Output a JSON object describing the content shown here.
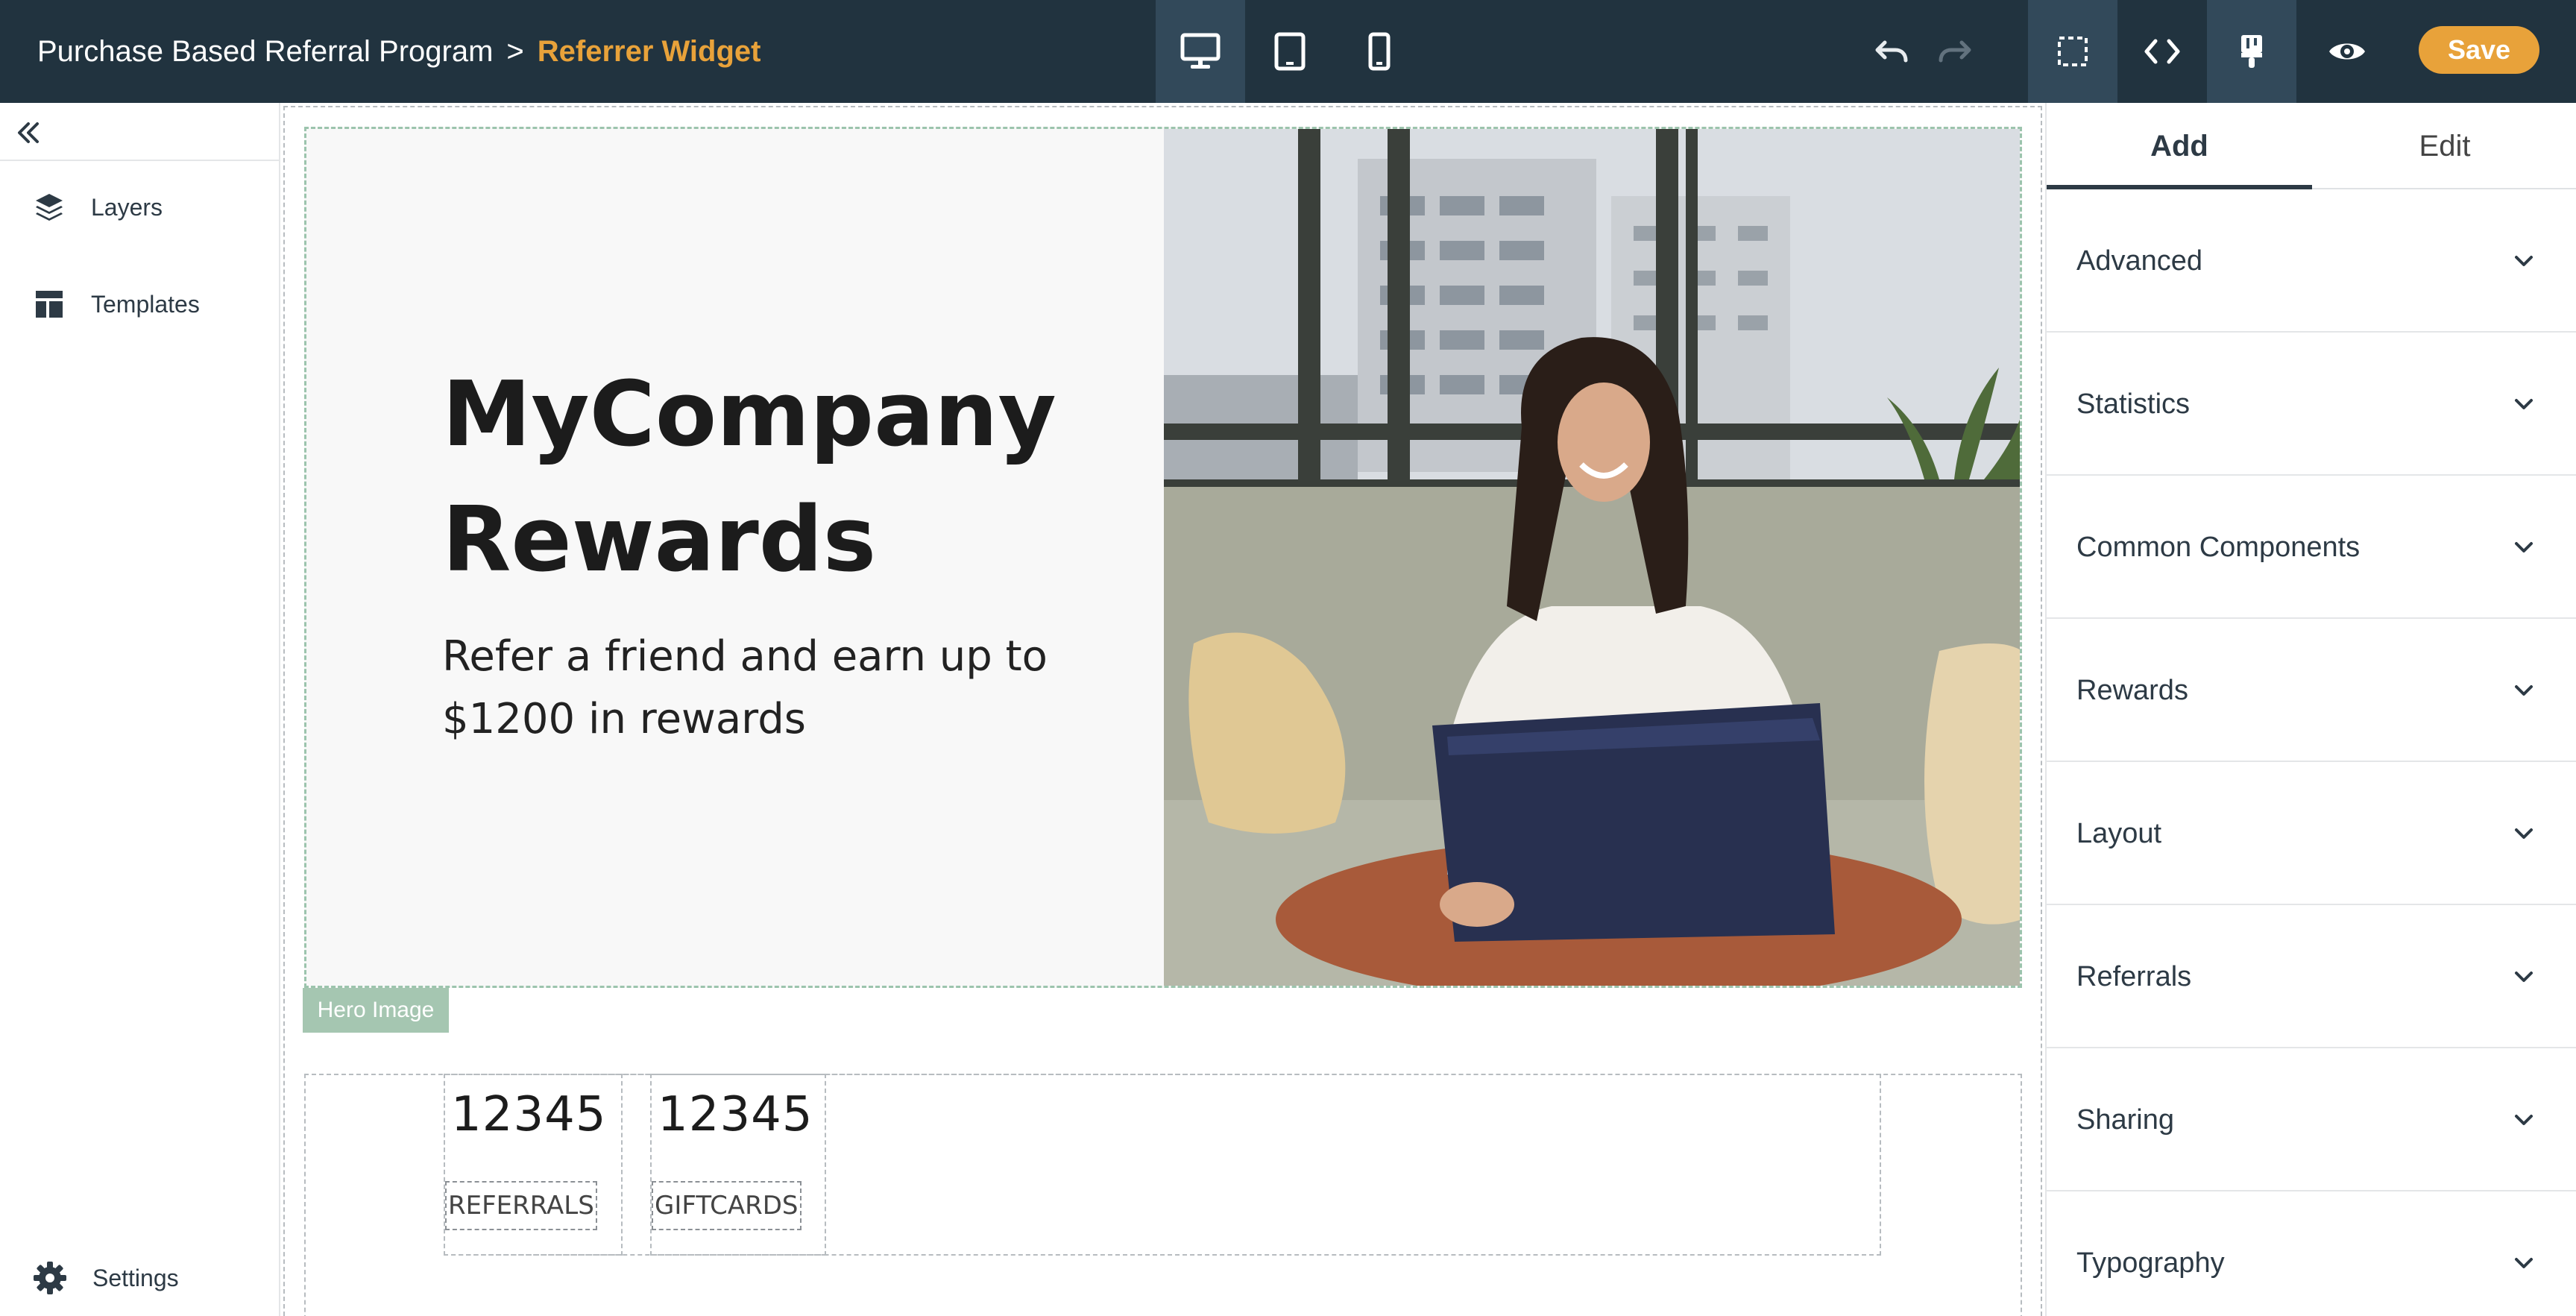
{
  "breadcrumb": {
    "parent": "Purchase Based Referral Program",
    "separator": ">",
    "current": "Referrer Widget"
  },
  "toolbar": {
    "icons": [
      "desktop-icon",
      "tablet-icon",
      "mobile-icon",
      "undo-icon",
      "redo-icon",
      "select-icon",
      "code-icon",
      "brush-icon",
      "eye-icon"
    ],
    "save_label": "Save"
  },
  "sidebar": {
    "items": [
      {
        "label": "Layers",
        "icon": "layers-icon"
      },
      {
        "label": "Templates",
        "icon": "templates-icon"
      }
    ],
    "settings_label": "Settings"
  },
  "hero": {
    "title_line1": "MyCompany",
    "title_line2": "Rewards",
    "subtitle_line1": "Refer a friend and earn up to",
    "subtitle_line2": "$1200 in rewards",
    "tag": "Hero Image"
  },
  "stats": [
    {
      "value": "12345",
      "label": "REFERRALS"
    },
    {
      "value": "12345",
      "label": "GIFTCARDS"
    }
  ],
  "panel": {
    "tabs": [
      {
        "label": "Add"
      },
      {
        "label": "Edit"
      }
    ],
    "sections": [
      {
        "label": "Advanced"
      },
      {
        "label": "Statistics"
      },
      {
        "label": "Common Components"
      },
      {
        "label": "Rewards"
      },
      {
        "label": "Layout"
      },
      {
        "label": "Referrals"
      },
      {
        "label": "Sharing"
      },
      {
        "label": "Typography"
      }
    ]
  },
  "colors": {
    "topbar": "#21333f",
    "accent": "#e8a23a",
    "hero_tag": "#a5c6b1"
  }
}
